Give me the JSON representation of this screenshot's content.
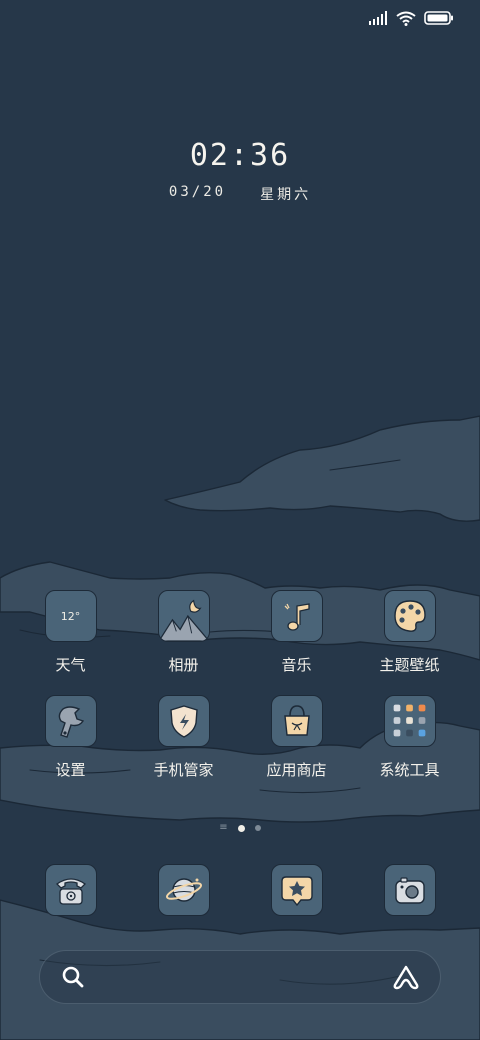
{
  "status_bar": {
    "signal": "signal-bars-icon",
    "wifi": "wifi-icon",
    "battery": "battery-icon"
  },
  "lockclock": {
    "time": "02:36",
    "date": "03/20",
    "weekday": "星期六"
  },
  "apps": [
    {
      "label": "天气",
      "icon": "weather-icon",
      "text": "12°"
    },
    {
      "label": "相册",
      "icon": "gallery-icon"
    },
    {
      "label": "音乐",
      "icon": "music-icon"
    },
    {
      "label": "主题壁纸",
      "icon": "palette-icon"
    },
    {
      "label": "设置",
      "icon": "wrench-icon"
    },
    {
      "label": "手机管家",
      "icon": "shield-icon"
    },
    {
      "label": "应用商店",
      "icon": "shopping-bag-icon"
    },
    {
      "label": "系统工具",
      "icon": "folder-icon"
    }
  ],
  "page_indicator": {
    "pages": 2,
    "current": 1
  },
  "dock": [
    {
      "icon": "phone-icon"
    },
    {
      "icon": "browser-planet-icon"
    },
    {
      "icon": "messages-icon"
    },
    {
      "icon": "camera-icon"
    }
  ],
  "search": {
    "left_icon": "search-icon",
    "right_icon": "assistant-icon"
  },
  "colors": {
    "background": "#263749",
    "cloud": "#3c4f61",
    "icon_bg": "#4a6478",
    "text": "#f4f2ec"
  }
}
